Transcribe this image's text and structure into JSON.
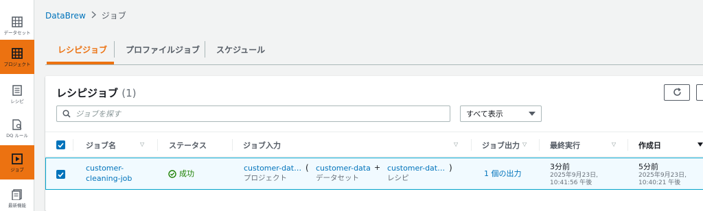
{
  "sidebar": {
    "items": [
      {
        "label": "データセット",
        "icon": "table-icon",
        "active": false
      },
      {
        "label": "プロジェクト",
        "icon": "project-grid-icon",
        "active": true
      },
      {
        "label": "レシピ",
        "icon": "recipe-list-icon",
        "active": false
      },
      {
        "label": "DQ ルール",
        "icon": "dq-rules-icon",
        "active": false
      },
      {
        "label": "ジョブ",
        "icon": "job-play-icon",
        "active": true
      },
      {
        "label": "最新機能",
        "icon": "whats-new-icon",
        "active": false
      }
    ]
  },
  "breadcrumb": {
    "root": "DataBrew",
    "current": "ジョブ"
  },
  "tabs": [
    "レシピジョブ",
    "プロファイルジョブ",
    "スケジュール"
  ],
  "panel": {
    "title": "レシピジョブ",
    "count": "(1)",
    "search_placeholder": "ジョブを探す",
    "filter_value": "すべて表示"
  },
  "table": {
    "columns": [
      "ジョブ名",
      "ステータス",
      "ジョブ入力",
      "ジョブ出力",
      "最終実行",
      "作成日"
    ],
    "rows": [
      {
        "name_line1": "customer-",
        "name_line2": "cleaning-job",
        "status": "成功",
        "input_project": "customer-dat…",
        "input_project_label": "プロジェクト",
        "input_plus": "+",
        "input_dataset": "customer-data",
        "input_dataset_label": "データセット",
        "input_recipe": "customer-dat…",
        "input_recipe_label": "レシピ",
        "paren_open": "(",
        "paren_close": ")",
        "output": "1 個の出力",
        "last_run": "3分前",
        "last_run_date": "2025年9月23日,",
        "last_run_time": "10:41:56 午後",
        "created": "5分前",
        "created_date": "2025年9月23日,",
        "created_time": "10:40:21 午後"
      }
    ]
  },
  "colors": {
    "accent": "#ec7211",
    "link": "#0073bb",
    "success": "#1d8102",
    "selected_row": "#f1faff"
  }
}
